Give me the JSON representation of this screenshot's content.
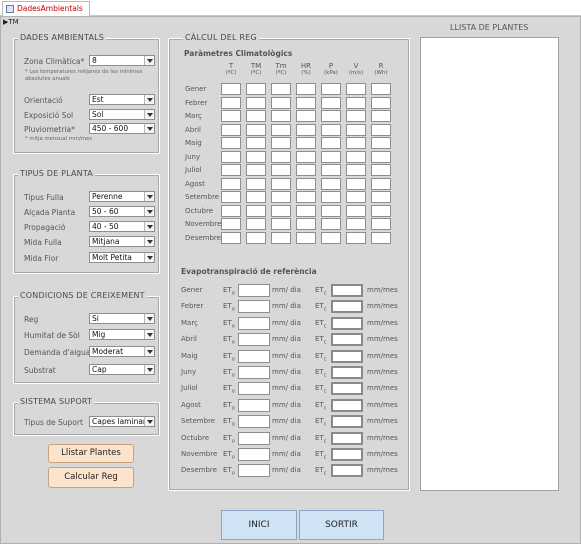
{
  "tab": {
    "title": "DadesAmbientals"
  },
  "record_selector": "▶TM",
  "ambient": {
    "title": "DADES AMBIENTALS",
    "zona_label": "Zona Climàtica*",
    "zona_value": "8",
    "zona_note": "* Les temperatures mitjanes de les mínimes absolutes anuals",
    "orientacio_label": "Orientació",
    "orientacio_value": "Est",
    "exposicio_label": "Exposició Sol",
    "exposicio_value": "Sol",
    "pluviometria_label": "Pluviometria*",
    "pluviometria_value": "450 - 600",
    "pluvio_note": "* mitja mensual mm/mes"
  },
  "planta": {
    "title": "TIPUS DE PLANTA",
    "rows": [
      {
        "label": "Tipus Fulla",
        "value": "Perenne"
      },
      {
        "label": "Alçada Planta",
        "value": "50 - 60"
      },
      {
        "label": "Propagació",
        "value": "40 - 50"
      },
      {
        "label": "Mida Fulla",
        "value": "Mitjana"
      },
      {
        "label": "Mida Flor",
        "value": "Molt Petita"
      }
    ]
  },
  "creixement": {
    "title": "CONDICIONS DE CREIXEMENT",
    "rows": [
      {
        "label": "Reg",
        "value": "Si"
      },
      {
        "label": "Humitat de Sòl",
        "value": "Mig"
      },
      {
        "label": "Demanda d'aigua",
        "value": "Moderat"
      },
      {
        "label": "Substrat",
        "value": "Cap"
      }
    ]
  },
  "suport": {
    "title": "SISTEMA SUPORT",
    "label": "Tipus de Suport",
    "value": "Capes laminars"
  },
  "buttons": {
    "llistar": "Llistar Plantes",
    "calcular": "Calcular Reg",
    "inici": "INICI",
    "sortir": "SORTIR"
  },
  "calcul": {
    "title": "CÀLCUL DEL REG",
    "params_title": "Paràmetres Climatològics",
    "columns": [
      {
        "name": "T",
        "unit": "(ºC)"
      },
      {
        "name": "TM",
        "unit": "(ºC)"
      },
      {
        "name": "Tm",
        "unit": "(ºC)"
      },
      {
        "name": "HR",
        "unit": "(%)"
      },
      {
        "name": "P",
        "unit": "(kPa)"
      },
      {
        "name": "V",
        "unit": "(m/s)"
      },
      {
        "name": "R",
        "unit": "(Wh)"
      }
    ],
    "months": [
      "Gener",
      "Febrer",
      "Març",
      "Abril",
      "Maig",
      "Juny",
      "Juliol",
      "Agost",
      "Setembre",
      "Octubre",
      "Novembre",
      "Desembre"
    ],
    "evap_title": "Evapotranspiració de referència",
    "eto": "ET",
    "eto_sub": "o",
    "etc_sub": "c",
    "unit_day": "mm/ dia",
    "unit_month": "mm/mes"
  },
  "llista": {
    "title": "LLISTA DE PLANTES"
  }
}
